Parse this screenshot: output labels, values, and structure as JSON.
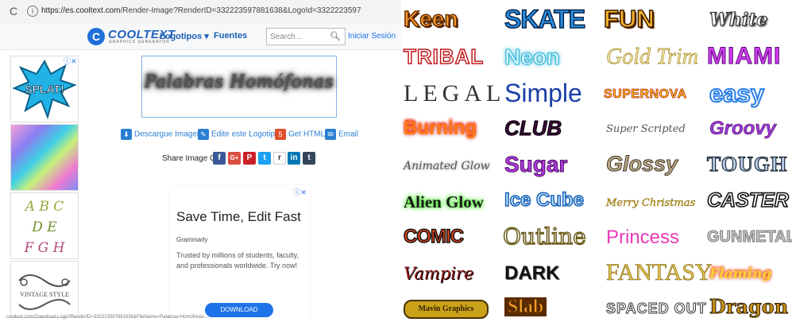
{
  "browser": {
    "reload_icon": "reload-icon",
    "url_host": "https://es.cooltext.com",
    "url_path": "/Render-Image?RenderID=332223597881638&LogoId=3322223597"
  },
  "nav": {
    "logo_text": "COOLTEXT",
    "logo_tagline": "GRAPHICS GENERATOR",
    "logotipos": "Logotipos ▾",
    "fuentes": "Fuentes",
    "search_placeholder": "Search...",
    "signin": "Iniciar Sesión"
  },
  "preview": {
    "text": "Palabras Homófonas"
  },
  "actions": {
    "download": "Descargue Imagen",
    "edit": "Edite este Logotipo",
    "html": "Get HTML",
    "email": "Email"
  },
  "share": {
    "label": "Share Image On",
    "buttons": [
      "f",
      "G+",
      "P",
      "t",
      "r",
      "in",
      "t"
    ]
  },
  "left_ads": {
    "splat": "SPLAT!",
    "abc_lines": [
      "A B C",
      "D E",
      "F G H"
    ],
    "vintage": "VINTAGE STYLE"
  },
  "ad": {
    "close": "ⓘ✕",
    "headline": "Save Time, Edit Fast",
    "brand": "Grammarly",
    "body": "Trusted by millions of students, faculty, and professionals worldwide. Try now!",
    "button": "DOWNLOAD"
  },
  "status_text": "cooltext.com/Download-Logo?RenderID=332223597881638&FileName=Palabras-Homófonas...",
  "font_styles": [
    "Keen",
    "SKATE",
    "FUN",
    "White",
    "TRIBAL",
    "Neon",
    "Gold Trim",
    "MIAMI",
    "LEGAL",
    "Simple",
    "SUPERNOVA",
    "easy",
    "Burning",
    "CLUB",
    "Super Scripted",
    "Groovy",
    "Animated Glow",
    "Sugar",
    "Glossy",
    "TOUGH",
    "Alien Glow",
    "Ice Cube",
    "Merry Christmas",
    "CASTER",
    "COMIC",
    "Outline",
    "Princess",
    "GUNMETAL",
    "Vampire",
    "DARK",
    "FANTASY",
    "Flaming",
    "Mavin Graphics",
    "Slab",
    "SPACED OUT",
    "Dragon"
  ]
}
